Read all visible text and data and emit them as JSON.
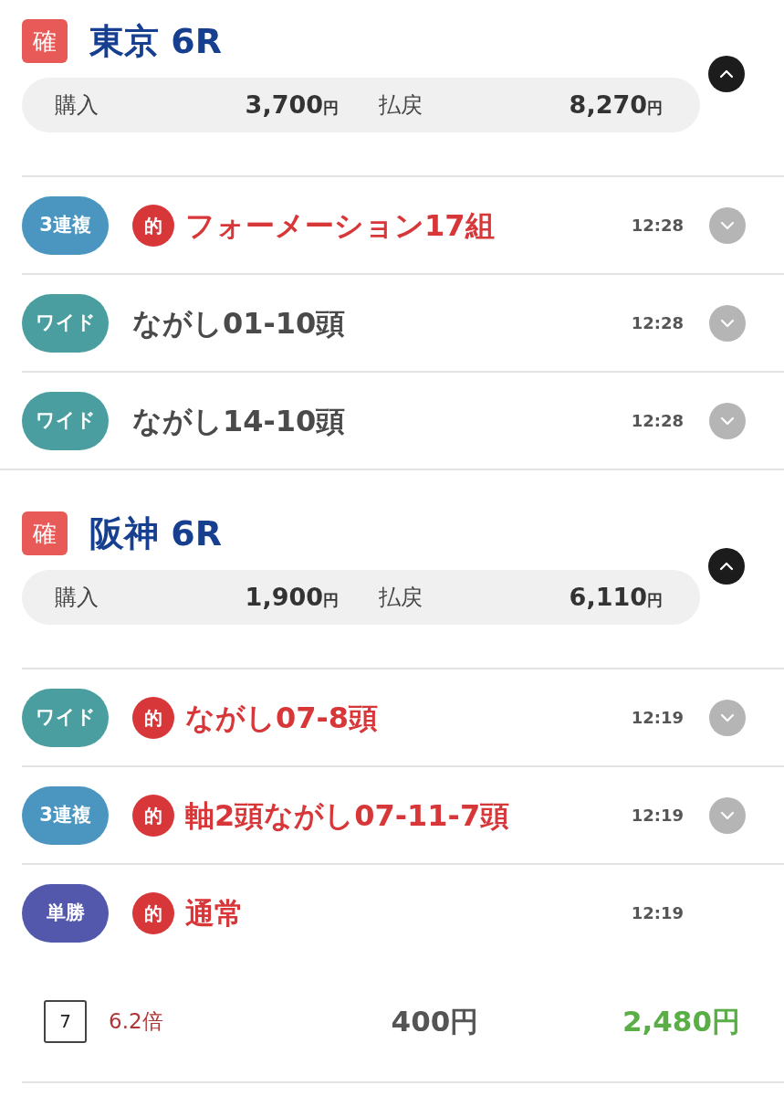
{
  "races": [
    {
      "status": "確",
      "title": "東京 6R",
      "expanded": true,
      "purchase": {
        "label": "購入",
        "value": "3,700",
        "unit": "円"
      },
      "payout": {
        "label": "払戻",
        "value": "8,270",
        "unit": "円"
      },
      "bets": [
        {
          "type": "3連複",
          "color": "#4a96c0",
          "hit": true,
          "hit_label": "的",
          "title": "フォーメーション17組",
          "time": "12:28",
          "expanded": false
        },
        {
          "type": "ワイド",
          "color": "#4a9ea0",
          "hit": false,
          "title": "ながし01-10頭",
          "time": "12:28",
          "expanded": false
        },
        {
          "type": "ワイド",
          "color": "#4a9ea0",
          "hit": false,
          "title": "ながし14-10頭",
          "time": "12:28",
          "expanded": false
        }
      ]
    },
    {
      "status": "確",
      "title": "阪神 6R",
      "expanded": true,
      "purchase": {
        "label": "購入",
        "value": "1,900",
        "unit": "円"
      },
      "payout": {
        "label": "払戻",
        "value": "6,110",
        "unit": "円"
      },
      "bets": [
        {
          "type": "ワイド",
          "color": "#4a9ea0",
          "hit": true,
          "hit_label": "的",
          "title": "ながし07-8頭",
          "time": "12:19",
          "expanded": false
        },
        {
          "type": "3連複",
          "color": "#4a96c0",
          "hit": true,
          "hit_label": "的",
          "title": "軸2頭ながし07-11-7頭",
          "time": "12:19",
          "expanded": false
        },
        {
          "type": "単勝",
          "color": "#5458ad",
          "hit": true,
          "hit_label": "的",
          "title": "通常",
          "time": "12:19",
          "expanded": true,
          "details": [
            {
              "horse": "7",
              "odds": "6.2倍",
              "amount": "400円",
              "payout": "2,480円"
            }
          ]
        }
      ]
    }
  ]
}
